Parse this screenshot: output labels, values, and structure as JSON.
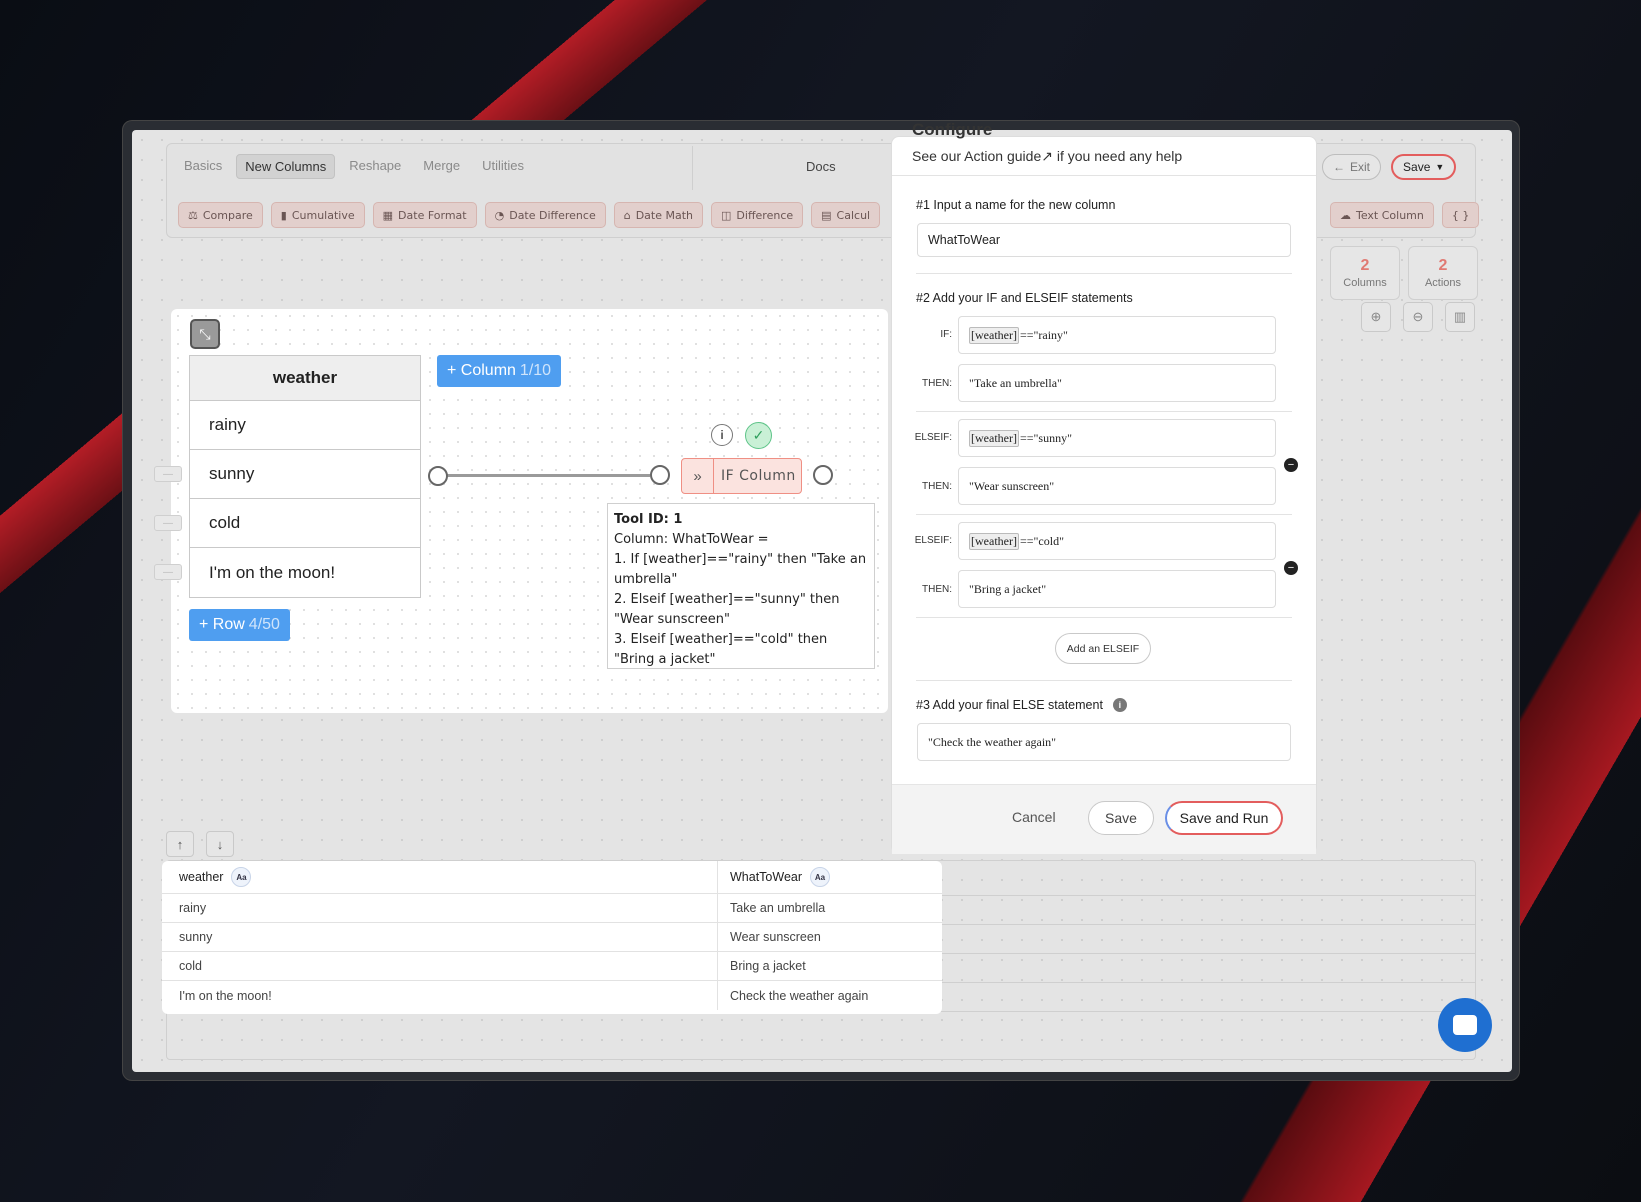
{
  "toolbar": {
    "tabs": [
      "Basics",
      "New Columns",
      "Reshape",
      "Merge",
      "Utilities"
    ],
    "docs_label": "Docs",
    "chips": [
      {
        "icon": "⚖",
        "label": "Compare"
      },
      {
        "icon": "▮",
        "label": "Cumulative"
      },
      {
        "icon": "▦",
        "label": "Date Format"
      },
      {
        "icon": "◔",
        "label": "Date Difference"
      },
      {
        "icon": "⌂",
        "label": "Date Math"
      },
      {
        "icon": "◫",
        "label": "Difference"
      },
      {
        "icon": "▤",
        "label": "Calcul"
      }
    ],
    "right_chips": [
      {
        "icon": "☁",
        "label": "Text Column"
      },
      {
        "icon": "",
        "label": "{ }"
      }
    ],
    "exit_label": "Exit",
    "save_label": "Save"
  },
  "stats": [
    {
      "value": "2",
      "label": "Columns"
    },
    {
      "value": "2",
      "label": "Actions"
    }
  ],
  "canvas": {
    "input_table": {
      "header": "weather",
      "rows": [
        "rainy",
        "sunny",
        "cold",
        "I'm on the moon!"
      ]
    },
    "add_column": {
      "label": "+ Column",
      "count": "1/10"
    },
    "add_row": {
      "label": "+ Row",
      "count": "4/50"
    },
    "node_label": "IF Column",
    "tooltip": {
      "lines": [
        "Tool ID: 1",
        "Column: WhatToWear =",
        "1. If [weather]==\"rainy\" then \"Take an umbrella\"",
        "2. Elseif [weather]==\"sunny\" then \"Wear sunscreen\"",
        "3. Elseif [weather]==\"cold\" then \"Bring a jacket\""
      ]
    }
  },
  "output_table": {
    "headers": [
      "weather",
      "WhatToWear"
    ],
    "type_badge": "Aa",
    "rows": [
      [
        "rainy",
        "Take an umbrella"
      ],
      [
        "sunny",
        "Wear sunscreen"
      ],
      [
        "cold",
        "Bring a jacket"
      ],
      [
        "I'm on the moon!",
        "Check the weather again"
      ]
    ]
  },
  "configure": {
    "title": "Configure",
    "subtitle_prefix": "See our",
    "guide_link": "Action guide↗",
    "subtitle_suffix": "if you need any help",
    "step1_label": "#1 Input a name for the new column",
    "column_name": "WhatToWear",
    "step2_label": "#2 Add your IF and ELSEIF statements",
    "conditions": [
      {
        "kind": "IF:",
        "column": "[weather]",
        "expr": "==\"rainy\"",
        "then_label": "THEN:",
        "then": "\"Take an umbrella\""
      },
      {
        "kind": "ELSEIF:",
        "column": "[weather]",
        "expr": "==\"sunny\"",
        "then_label": "THEN:",
        "then": "\"Wear sunscreen\""
      },
      {
        "kind": "ELSEIF:",
        "column": "[weather]",
        "expr": "==\"cold\"",
        "then_label": "THEN:",
        "then": "\"Bring a jacket\""
      }
    ],
    "add_elseif_label": "Add an ELSEIF",
    "step3_label": "#3 Add your final ELSE statement",
    "else_value": "\"Check the weather again\"",
    "cancel_label": "Cancel",
    "save_label": "Save",
    "save_run_label": "Save and Run"
  }
}
